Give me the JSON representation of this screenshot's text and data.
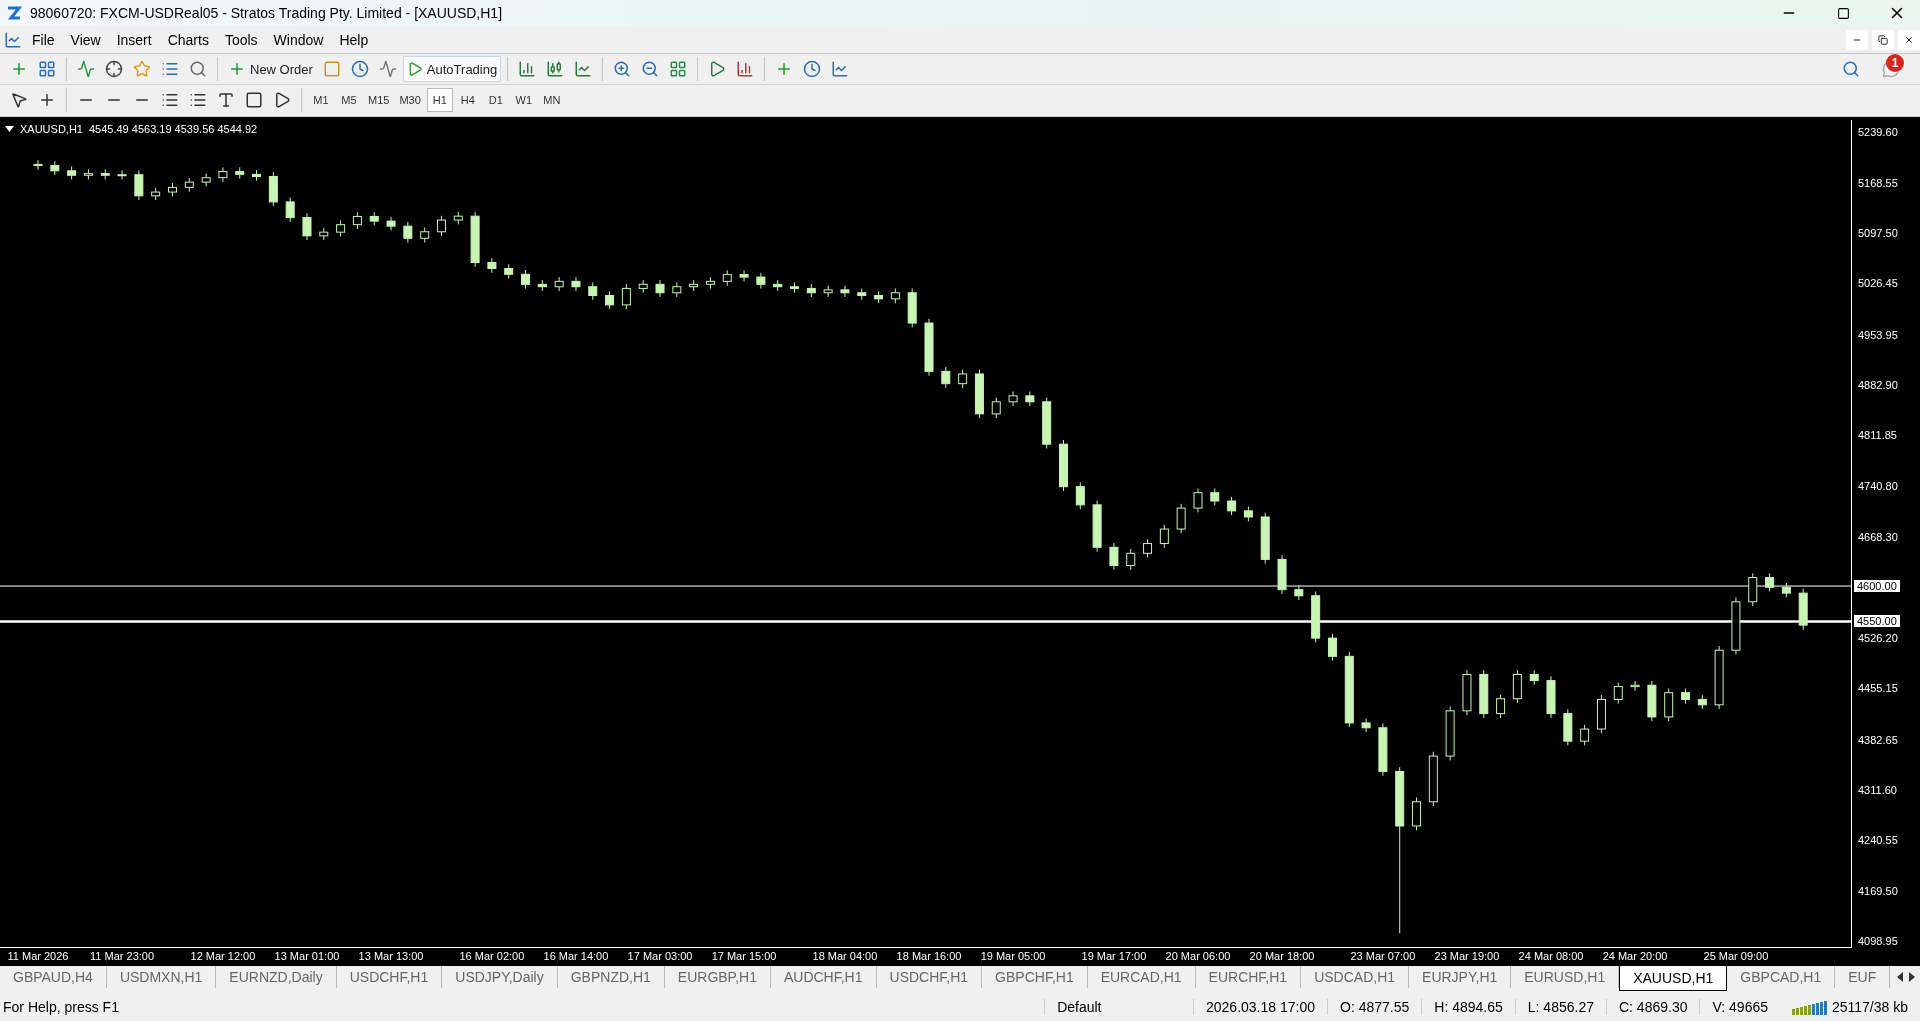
{
  "window": {
    "title": "98060720: FXCM-USDReal05 - Stratos Trading Pty. Limited - [XAUUSD,H1]"
  },
  "menu": [
    {
      "label": "File"
    },
    {
      "label": "View"
    },
    {
      "label": "Insert"
    },
    {
      "label": "Charts"
    },
    {
      "label": "Tools"
    },
    {
      "label": "Window"
    },
    {
      "label": "Help"
    }
  ],
  "toolbar": {
    "new_order": "New Order",
    "auto_trading": "AutoTrading",
    "notifications_badge": "1"
  },
  "timeframes": [
    {
      "label": "M1",
      "selected": false
    },
    {
      "label": "M5",
      "selected": false
    },
    {
      "label": "M15",
      "selected": false
    },
    {
      "label": "M30",
      "selected": false
    },
    {
      "label": "H1",
      "selected": true
    },
    {
      "label": "H4",
      "selected": false
    },
    {
      "label": "D1",
      "selected": false
    },
    {
      "label": "W1",
      "selected": false
    },
    {
      "label": "MN",
      "selected": false
    }
  ],
  "chart": {
    "header_values": "4545.49 4563.19 4539.56 4544.92",
    "chart_data": {
      "type": "candlestick",
      "title": "XAUUSD,H1",
      "ylim": [
        4089.2,
        5257.7
      ],
      "yticks": [
        {
          "value": 5239.6,
          "label": "5239.60"
        },
        {
          "value": 5168.55,
          "label": "5168.55"
        },
        {
          "value": 5097.5,
          "label": "5097.50"
        },
        {
          "value": 5026.45,
          "label": "5026.45"
        },
        {
          "value": 4953.95,
          "label": "4953.95"
        },
        {
          "value": 4882.9,
          "label": "4882.90"
        },
        {
          "value": 4811.85,
          "label": "4811.85"
        },
        {
          "value": 4740.8,
          "label": "4740.80"
        },
        {
          "value": 4668.3,
          "label": "4668.30"
        },
        {
          "value": 4526.2,
          "label": "4526.20"
        },
        {
          "value": 4455.15,
          "label": "4455.15"
        },
        {
          "value": 4382.65,
          "label": "4382.65"
        },
        {
          "value": 4311.6,
          "label": "4311.60"
        },
        {
          "value": 4240.55,
          "label": "4240.55"
        },
        {
          "value": 4169.5,
          "label": "4169.50"
        },
        {
          "value": 4098.95,
          "label": "4098.95"
        }
      ],
      "categories": [
        "11 Mar 2026",
        null,
        null,
        null,
        null,
        "11 Mar 23:00",
        null,
        null,
        null,
        null,
        null,
        "12 Mar 12:00",
        null,
        null,
        null,
        null,
        "13 Mar 01:00",
        null,
        null,
        null,
        null,
        "13 Mar 13:00",
        null,
        null,
        null,
        null,
        null,
        "16 Mar 02:00",
        null,
        null,
        null,
        null,
        "16 Mar 14:00",
        null,
        null,
        null,
        null,
        "17 Mar 03:00",
        null,
        null,
        null,
        null,
        "17 Mar 15:00",
        null,
        null,
        null,
        null,
        null,
        "18 Mar 04:00",
        null,
        null,
        null,
        null,
        "18 Mar 16:00",
        null,
        null,
        null,
        null,
        "19 Mar 05:00",
        null,
        null,
        null,
        null,
        null,
        "19 Mar 17:00",
        null,
        null,
        null,
        null,
        "20 Mar 06:00",
        null,
        null,
        null,
        null,
        "20 Mar 18:00",
        null,
        null,
        null,
        null,
        null,
        "23 Mar 07:00",
        null,
        null,
        null,
        null,
        "23 Mar 19:00",
        null,
        null,
        null,
        null,
        "24 Mar 08:00",
        null,
        null,
        null,
        null,
        "24 Mar 20:00",
        null,
        null,
        null,
        null,
        null,
        "25 Mar 09:00",
        null,
        null,
        null,
        null
      ],
      "ohlc": [
        [
          5195.0,
          5201.0,
          5187.4,
          5193.4
        ],
        [
          5193.4,
          5199.4,
          5180.0,
          5186.0
        ],
        [
          5186.0,
          5192.0,
          5173.7,
          5179.7
        ],
        [
          5179.7,
          5188.0,
          5173.7,
          5182.0
        ],
        [
          5182.0,
          5188.0,
          5173.7,
          5179.7
        ],
        [
          5179.7,
          5186.5,
          5173.7,
          5180.5
        ],
        [
          5180.5,
          5186.5,
          5144.7,
          5150.7
        ],
        [
          5150.7,
          5162.0,
          5144.7,
          5156.0
        ],
        [
          5156.0,
          5168.6,
          5150.0,
          5162.6
        ],
        [
          5162.6,
          5176.0,
          5156.6,
          5170.0
        ],
        [
          5170.0,
          5182.3,
          5164.0,
          5176.3
        ],
        [
          5176.3,
          5190.9,
          5170.3,
          5184.9
        ],
        [
          5184.9,
          5190.9,
          5175.0,
          5181.0
        ],
        [
          5181.0,
          5187.0,
          5172.0,
          5178.0
        ],
        [
          5178.0,
          5184.0,
          5136.1,
          5142.1
        ],
        [
          5142.1,
          5148.1,
          5114.0,
          5120.0
        ],
        [
          5120.0,
          5126.0,
          5088.2,
          5094.2
        ],
        [
          5094.2,
          5105.4,
          5088.2,
          5099.4
        ],
        [
          5099.4,
          5116.0,
          5093.4,
          5110.0
        ],
        [
          5110.0,
          5127.6,
          5104.0,
          5121.6
        ],
        [
          5121.6,
          5127.6,
          5109.0,
          5115.0
        ],
        [
          5115.0,
          5121.0,
          5101.9,
          5107.9
        ],
        [
          5107.9,
          5113.9,
          5084.8,
          5090.8
        ],
        [
          5090.8,
          5106.0,
          5084.8,
          5100.0
        ],
        [
          5100.0,
          5122.5,
          5094.0,
          5116.5
        ],
        [
          5116.5,
          5128.0,
          5110.5,
          5122.0
        ],
        [
          5122.0,
          5128.0,
          5050.6,
          5056.6
        ],
        [
          5056.6,
          5062.6,
          5042.1,
          5048.1
        ],
        [
          5048.1,
          5054.1,
          5034.0,
          5040.0
        ],
        [
          5040.0,
          5046.0,
          5019.8,
          5025.8
        ],
        [
          5025.8,
          5031.8,
          5016.4,
          5022.4
        ],
        [
          5022.4,
          5036.0,
          5016.4,
          5030.0
        ],
        [
          5030.0,
          5036.0,
          5016.4,
          5022.4
        ],
        [
          5022.4,
          5028.4,
          5004.0,
          5010.0
        ],
        [
          5010.0,
          5016.0,
          4990.8,
          4996.8
        ],
        [
          4996.8,
          5026.0,
          4990.8,
          5020.0
        ],
        [
          5020.0,
          5031.8,
          5014.0,
          5025.8
        ],
        [
          5025.8,
          5031.8,
          5007.9,
          5013.9
        ],
        [
          5013.9,
          5028.4,
          5007.9,
          5022.4
        ],
        [
          5022.4,
          5031.8,
          5016.4,
          5025.8
        ],
        [
          5025.8,
          5036.0,
          5019.8,
          5030.0
        ],
        [
          5030.0,
          5045.5,
          5024.0,
          5039.5
        ],
        [
          5039.5,
          5045.5,
          5030.0,
          5036.0
        ],
        [
          5036.0,
          5042.0,
          5019.8,
          5025.8
        ],
        [
          5025.8,
          5031.8,
          5016.4,
          5022.4
        ],
        [
          5022.4,
          5028.4,
          5014.0,
          5020.0
        ],
        [
          5020.0,
          5026.0,
          5007.9,
          5013.9
        ],
        [
          5013.9,
          5024.0,
          5007.9,
          5018.0
        ],
        [
          5018.0,
          5024.0,
          5007.9,
          5013.9
        ],
        [
          5013.9,
          5019.9,
          5004.0,
          5010.0
        ],
        [
          5010.0,
          5016.0,
          4999.3,
          5005.3
        ],
        [
          5005.3,
          5019.9,
          4999.3,
          5013.9
        ],
        [
          5013.9,
          5019.9,
          4965.1,
          4971.1
        ],
        [
          4971.1,
          4977.1,
          4897.0,
          4903.0
        ],
        [
          4903.0,
          4909.0,
          4879.6,
          4885.6
        ],
        [
          4885.6,
          4905.3,
          4879.6,
          4899.3
        ],
        [
          4899.3,
          4905.3,
          4837.0,
          4843.0
        ],
        [
          4843.0,
          4866.0,
          4837.0,
          4860.0
        ],
        [
          4860.0,
          4874.5,
          4854.0,
          4868.5
        ],
        [
          4868.5,
          4874.5,
          4854.0,
          4860.0
        ],
        [
          4860.0,
          4866.0,
          4794.2,
          4800.2
        ],
        [
          4800.2,
          4806.2,
          4734.2,
          4740.2
        ],
        [
          4740.2,
          4746.2,
          4708.6,
          4714.6
        ],
        [
          4714.6,
          4720.6,
          4648.7,
          4654.7
        ],
        [
          4654.7,
          4660.7,
          4623.1,
          4629.1
        ],
        [
          4629.1,
          4652.2,
          4623.1,
          4646.2
        ],
        [
          4646.2,
          4666.0,
          4640.2,
          4660.0
        ],
        [
          4660.0,
          4686.4,
          4654.0,
          4680.4
        ],
        [
          4680.4,
          4716.0,
          4674.4,
          4710.0
        ],
        [
          4710.0,
          4737.7,
          4704.0,
          4731.7
        ],
        [
          4731.7,
          4737.7,
          4714.0,
          4720.0
        ],
        [
          4720.0,
          4726.0,
          4700.1,
          4706.1
        ],
        [
          4706.1,
          4712.1,
          4691.5,
          4697.5
        ],
        [
          4697.5,
          4703.5,
          4631.6,
          4637.6
        ],
        [
          4637.6,
          4643.6,
          4588.9,
          4594.9
        ],
        [
          4594.9,
          4600.9,
          4580.3,
          4586.3
        ],
        [
          4586.3,
          4592.3,
          4520.5,
          4526.5
        ],
        [
          4526.5,
          4532.5,
          4494.8,
          4500.8
        ],
        [
          4500.8,
          4506.8,
          4400.8,
          4406.8
        ],
        [
          4406.8,
          4412.8,
          4394.0,
          4400.0
        ],
        [
          4400.0,
          4406.0,
          4332.4,
          4338.4
        ],
        [
          4338.4,
          4344.4,
          4110.0,
          4261.4
        ],
        [
          4261.4,
          4301.6,
          4255.4,
          4295.6
        ],
        [
          4295.6,
          4366.0,
          4289.6,
          4360.0
        ],
        [
          4360.0,
          4429.9,
          4354.0,
          4423.9
        ],
        [
          4423.9,
          4481.2,
          4417.9,
          4475.2
        ],
        [
          4475.2,
          4481.2,
          4414.0,
          4420.0
        ],
        [
          4420.0,
          4447.0,
          4414.0,
          4441.0
        ],
        [
          4441.0,
          4481.2,
          4435.0,
          4475.2
        ],
        [
          4475.2,
          4481.2,
          4460.6,
          4466.6
        ],
        [
          4466.6,
          4472.6,
          4414.0,
          4420.0
        ],
        [
          4420.0,
          4426.0,
          4375.1,
          4381.1
        ],
        [
          4381.1,
          4404.2,
          4375.1,
          4398.2
        ],
        [
          4398.2,
          4446.0,
          4392.2,
          4440.0
        ],
        [
          4440.0,
          4464.1,
          4434.0,
          4458.1
        ],
        [
          4458.1,
          4466.0,
          4452.1,
          4460.0
        ],
        [
          4460.0,
          4466.0,
          4409.3,
          4415.3
        ],
        [
          4415.3,
          4455.5,
          4409.3,
          4449.5
        ],
        [
          4449.5,
          4455.5,
          4434.0,
          4440.0
        ],
        [
          4440.0,
          4446.0,
          4426.4,
          4432.4
        ],
        [
          4432.4,
          4515.4,
          4426.4,
          4509.4
        ],
        [
          4509.4,
          4583.8,
          4503.4,
          4577.8
        ],
        [
          4577.8,
          4618.0,
          4571.8,
          4612.0
        ],
        [
          4612.0,
          4618.0,
          4592.3,
          4598.3
        ],
        [
          4598.3,
          4604.3,
          4584.0,
          4590.0
        ],
        [
          4590.0,
          4596.3,
          4538.0,
          4544.9
        ]
      ],
      "ref_lines": [
        {
          "axis": "y",
          "value": 4600,
          "label": "4600.00"
        },
        {
          "axis": "y",
          "value": 4550,
          "label": "4550.00"
        }
      ]
    }
  },
  "chart_tabs": [
    {
      "label": "GBPAUD,H4",
      "selected": false
    },
    {
      "label": "USDMXN,H1",
      "selected": false
    },
    {
      "label": "EURNZD,Daily",
      "selected": false
    },
    {
      "label": "USDCHF,H1",
      "selected": false
    },
    {
      "label": "USDJPY,Daily",
      "selected": false
    },
    {
      "label": "GBPNZD,H1",
      "selected": false
    },
    {
      "label": "EURGBP,H1",
      "selected": false
    },
    {
      "label": "AUDCHF,H1",
      "selected": false
    },
    {
      "label": "USDCHF,H1",
      "selected": false
    },
    {
      "label": "GBPCHF,H1",
      "selected": false
    },
    {
      "label": "EURCAD,H1",
      "selected": false
    },
    {
      "label": "EURCHF,H1",
      "selected": false
    },
    {
      "label": "USDCAD,H1",
      "selected": false
    },
    {
      "label": "EURJPY,H1",
      "selected": false
    },
    {
      "label": "EURUSD,H1",
      "selected": false
    },
    {
      "label": "XAUUSD,H1",
      "selected": true
    },
    {
      "label": "GBPCAD,H1",
      "selected": false
    },
    {
      "label": "EUF",
      "selected": false
    }
  ],
  "status_bar": {
    "help": "For Help, press F1",
    "profile": "Default",
    "time": "2026.03.18 17:00",
    "open": "O: 4877.55",
    "high": "H: 4894.65",
    "low": "L: 4856.27",
    "close": "C: 4869.30",
    "volume": "V: 49665",
    "traffic": "25117/38 kb"
  }
}
